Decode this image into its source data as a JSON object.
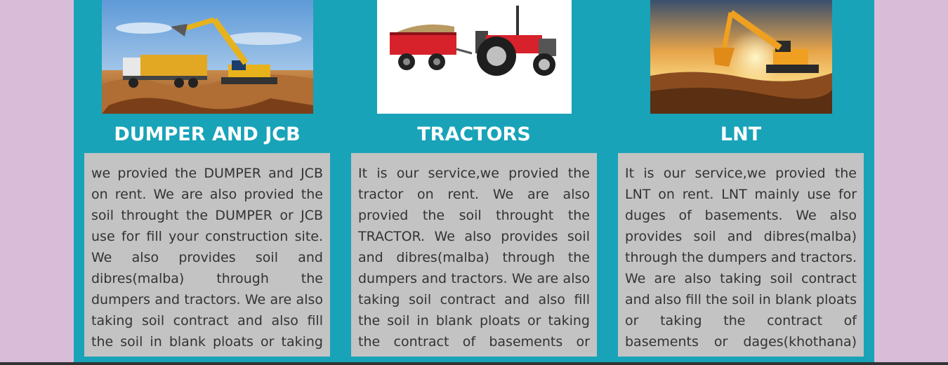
{
  "cards": [
    {
      "title": "DUMPER AND JCB",
      "image_icon": "excavator-dumper-photo",
      "text": "we provied the DUMPER and JCB on rent. We are also provied the soil throught the DUMPER or JCB use for fill your construction site. We also provides soil and dibres(malba) through the dumpers and tractors. We are also taking soil contract and also fill the soil in blank ploats or taking the contract of basements or dages(khothana) the basements. ."
    },
    {
      "title": "TRACTORS",
      "image_icon": "tractor-trolley-photo",
      "text": "It is our service,we provied the tractor on rent. We are also provied the soil throught the TRACTOR. We also provides soil and dibres(malba) through the dumpers and tractors. We are also taking soil contract and also fill the soil in blank ploats or taking the contract of basements or dages(khothana) the basements. . We are broking(destract) the old"
    },
    {
      "title": "LNT",
      "image_icon": "excavator-sunset-photo",
      "text": "It is our service,we provied the LNT on rent. LNT mainly use for duges of basements. We also provides soil and dibres(malba) through the dumpers and tractors. We are also taking soil contract and also fill the soil in blank ploats or taking the contract of basements or dages(khothana) the basements. . We are broking(destract) the old houses and"
    }
  ],
  "colors": {
    "page_background": "#d9bcd7",
    "container_background": "#18a3b8",
    "text_box_background": "#c3c3c3",
    "title_text": "#ffffff",
    "body_text": "#333333"
  }
}
